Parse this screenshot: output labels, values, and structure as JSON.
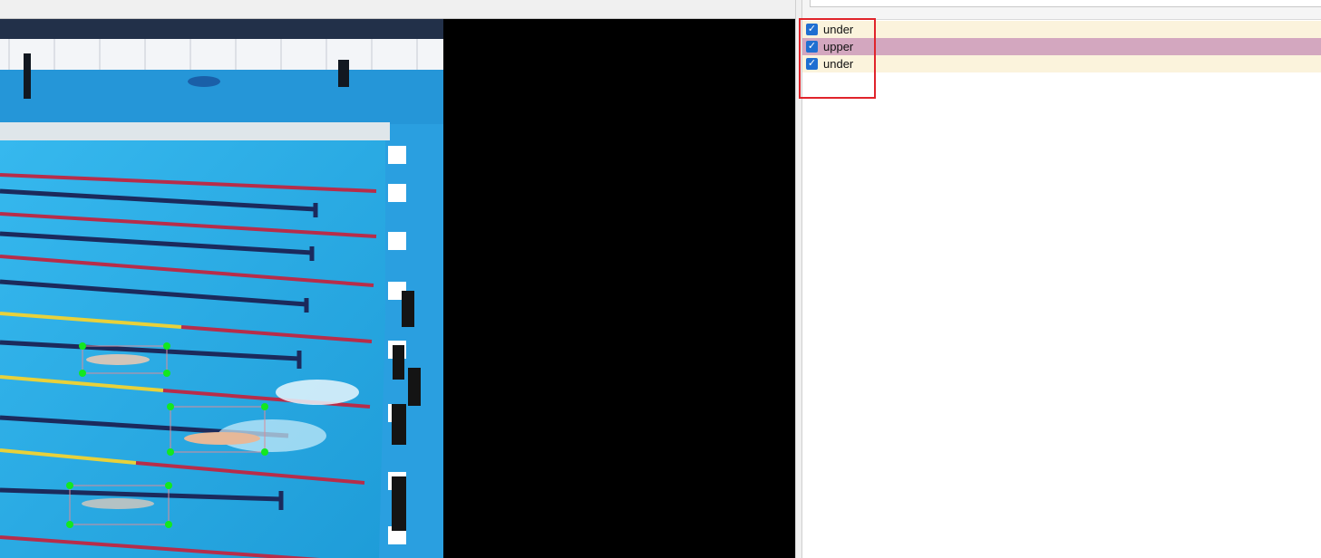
{
  "labels": {
    "items": [
      {
        "text": "under",
        "checked": true,
        "bg": "#fbf3dc"
      },
      {
        "text": "upper",
        "checked": true,
        "bg": "#d3a7bf"
      },
      {
        "text": "under",
        "checked": true,
        "bg": "#fbf3dc"
      }
    ]
  },
  "colors": {
    "pool_water": "#21a9e6",
    "annotation_box": "#d88d9a",
    "annotation_handle": "#13e81f",
    "highlight_frame": "#e0242b",
    "checkbox": "#1f6fd1"
  },
  "icons": {
    "checkbox": "check-mark"
  }
}
